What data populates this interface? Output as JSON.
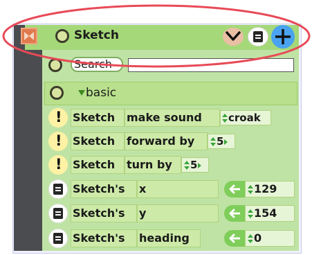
{
  "header": {
    "title": "Sketch"
  },
  "search": {
    "label": "Search",
    "value": ""
  },
  "category": {
    "label": "basic"
  },
  "blocks": {
    "make_sound": {
      "object": "Sketch",
      "command": "make sound",
      "value": "croak"
    },
    "forward": {
      "object": "Sketch",
      "command": "forward by",
      "value": "5"
    },
    "turn": {
      "object": "Sketch",
      "command": "turn by",
      "value": "5"
    }
  },
  "properties": [
    {
      "object": "Sketch's",
      "name": "x",
      "value": "129"
    },
    {
      "object": "Sketch's",
      "name": "y",
      "value": "154"
    },
    {
      "object": "Sketch's",
      "name": "heading",
      "value": "0"
    }
  ],
  "colors": {
    "panel": "#bfe3a4",
    "header": "#a5d879",
    "accent_blue": "#4aa3f0",
    "annotation": "#e84a57"
  }
}
